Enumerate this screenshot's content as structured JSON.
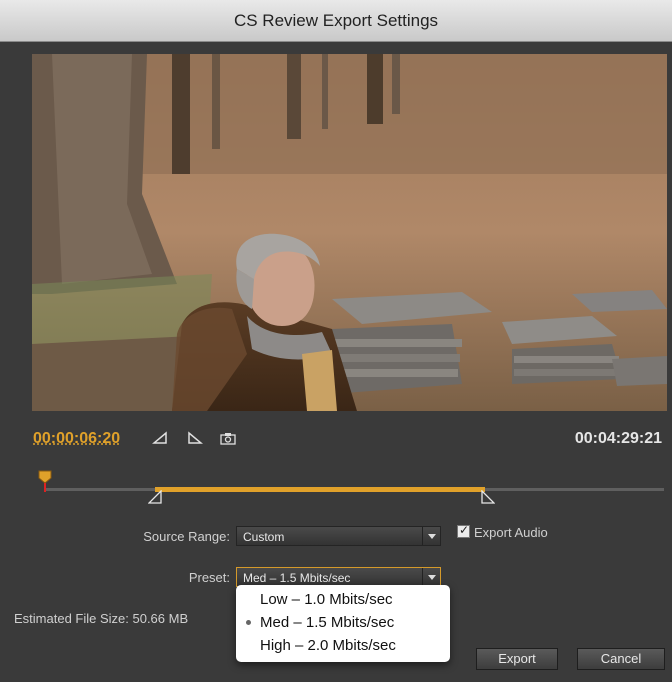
{
  "window": {
    "title": "CS Review Export Settings"
  },
  "transport": {
    "current_timecode": "00:00:06:20",
    "total_timecode": "00:04:29:21"
  },
  "form": {
    "source_range_label": "Source Range:",
    "source_range_value": "Custom",
    "export_audio_label": "Export Audio",
    "export_audio_checked": true,
    "preset_label": "Preset:",
    "preset_value": "Med – 1.5 Mbits/sec",
    "estimated_size_label": "Estimated File Size: 50.66 MB"
  },
  "preset_menu": {
    "options": [
      {
        "label": "Low – 1.0 Mbits/sec",
        "selected": false
      },
      {
        "label": "Med – 1.5 Mbits/sec",
        "selected": true
      },
      {
        "label": "High – 2.0 Mbits/sec",
        "selected": false
      }
    ]
  },
  "buttons": {
    "export": "Export",
    "cancel": "Cancel"
  },
  "colors": {
    "accent": "#e0a12a",
    "panel_bg": "#3a3a3a"
  }
}
